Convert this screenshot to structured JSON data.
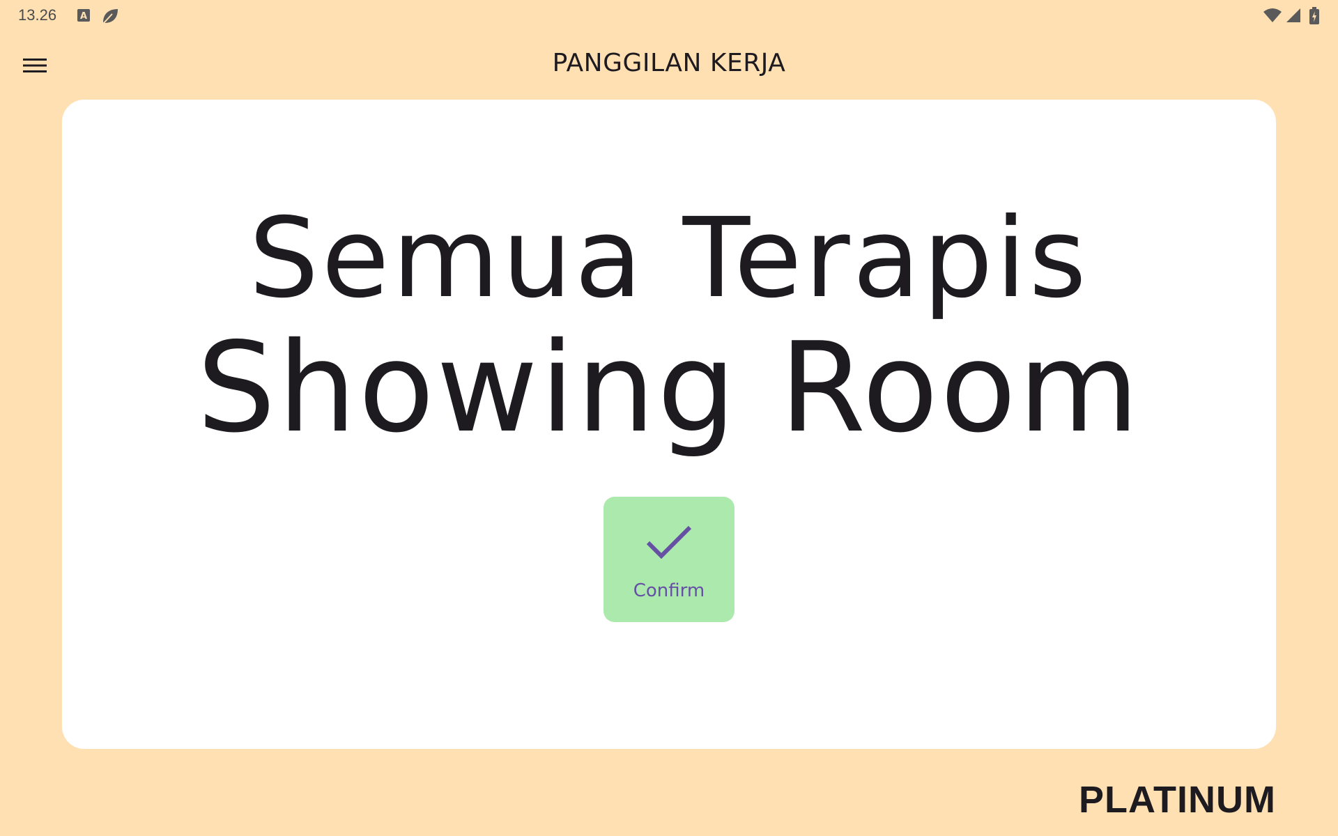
{
  "status_bar": {
    "time": "13.26",
    "icons": [
      "keyboard-a-icon",
      "leaf-icon",
      "wifi-icon",
      "signal-icon",
      "battery-charging-icon"
    ]
  },
  "app_bar": {
    "menu_icon": "hamburger-menu-icon",
    "title": "PANGGILAN KERJA"
  },
  "card": {
    "line1": "Semua Terapis",
    "line2": "Showing Room",
    "confirm_button": {
      "icon": "checkmark-icon",
      "label": "Confirm"
    }
  },
  "footer": {
    "tier": "PLATINUM"
  },
  "colors": {
    "background": "#FFE0B2",
    "card": "#FFFFFF",
    "confirm_bg": "#ABE9AC",
    "confirm_accent": "#6650A4",
    "text": "#1D1B20"
  }
}
